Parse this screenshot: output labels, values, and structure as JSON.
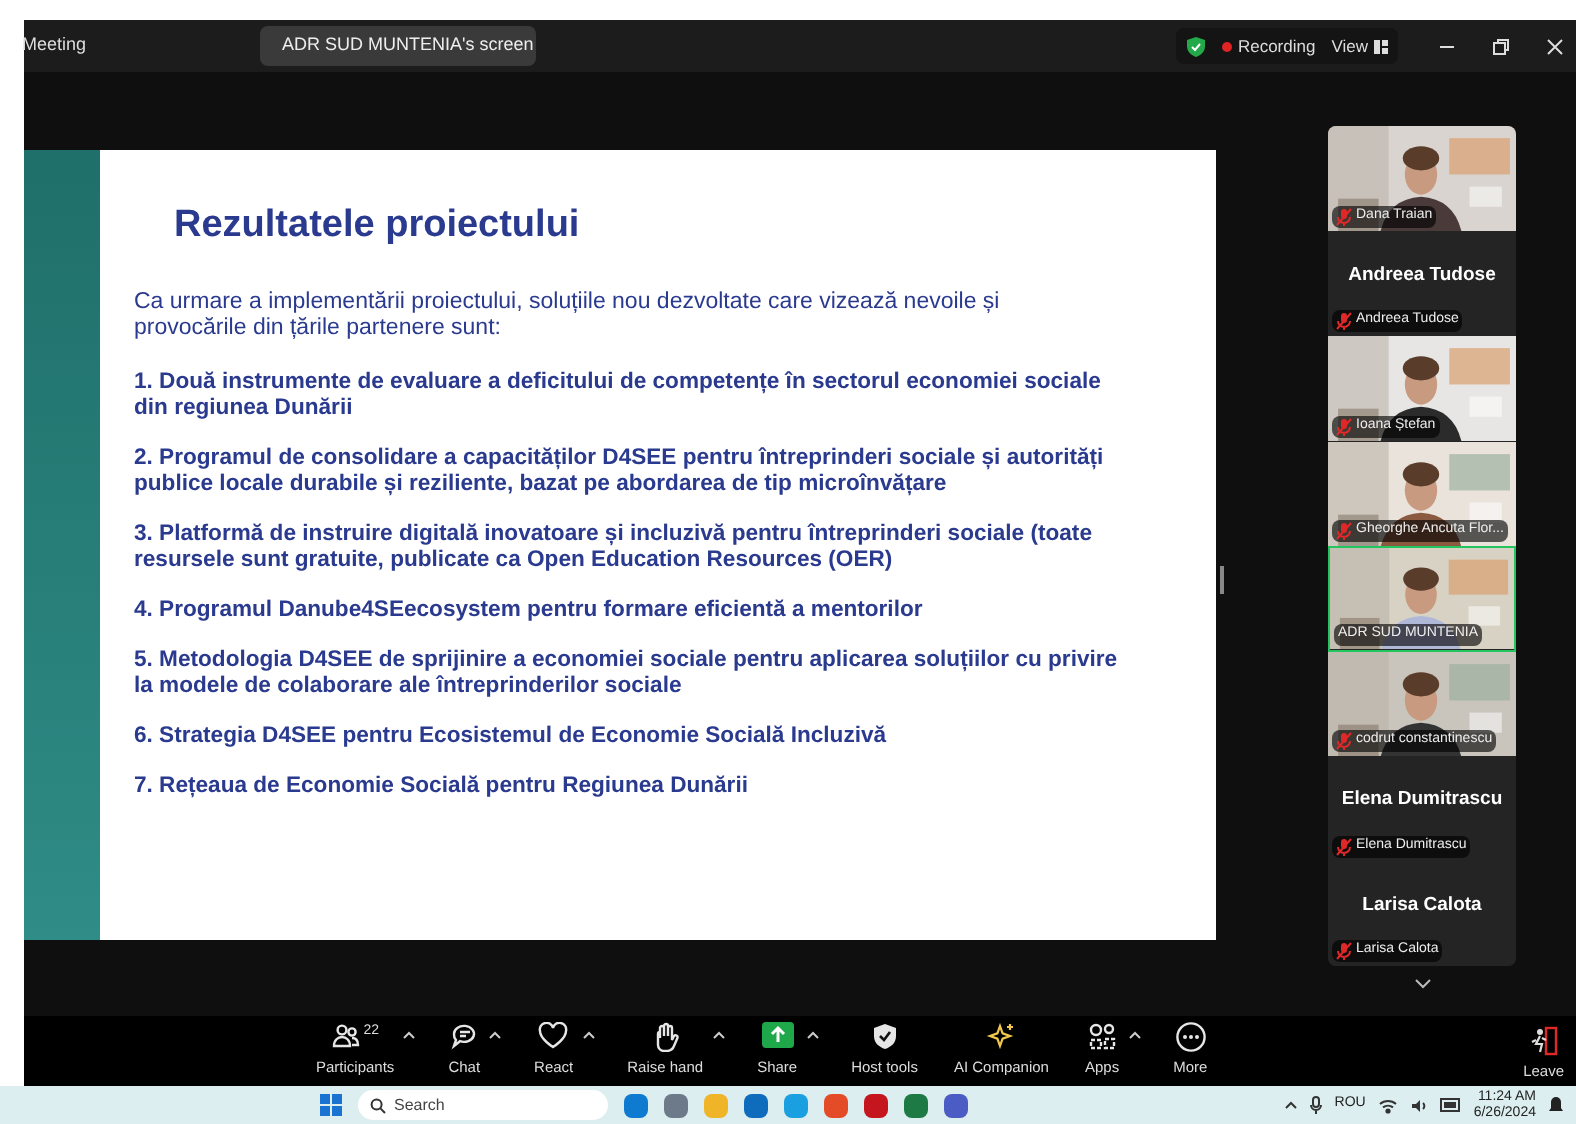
{
  "window": {
    "title": "Meeting"
  },
  "share_pill": {
    "label": "ADR SUD MUNTENIA's screen"
  },
  "top_right": {
    "recording": "Recording",
    "view": "View"
  },
  "slide": {
    "title": "Rezultatele proiectului",
    "intro": "Ca urmare a implementării proiectului, soluțiile nou dezvoltate care vizează nevoile și provocările din țările partenere sunt:",
    "items": [
      "1. Două instrumente de evaluare a deficitului de competențe în sectorul economiei sociale din regiunea Dunării",
      "2. Programul de consolidare a capacităților D4SEE pentru întreprinderi sociale și autorități publice locale durabile și reziliente, bazat pe abordarea de tip microînvățare",
      "3. Platformă de instruire digitală inovatoare și incluzivă pentru întreprinderi sociale (toate resursele sunt gratuite, publicate ca Open Education Resources (OER)",
      "4. Programul Danube4SEecosystem pentru formare eficientă a mentorilor",
      "5. Metodologia D4SEE de sprijinire a economiei sociale pentru aplicarea soluțiilor cu privire la modele de colaborare ale întreprinderilor sociale",
      "6. Strategia D4SEE pentru Ecosistemul de Economie Socială Incluzivă",
      "7. Rețeaua de Economie Socială pentru Regiunea Dunării"
    ]
  },
  "participants": [
    {
      "kind": "video",
      "name": "Dana Traian",
      "muted": true,
      "speaking": false
    },
    {
      "kind": "name",
      "title": "Andreea Tudose",
      "name": "Andreea Tudose",
      "muted": true,
      "speaking": false
    },
    {
      "kind": "video",
      "name": "Ioana Ștefan",
      "muted": true,
      "speaking": false
    },
    {
      "kind": "video",
      "name": "Gheorghe Ancuta Flor...",
      "muted": true,
      "speaking": false
    },
    {
      "kind": "video",
      "name": "ADR SUD MUNTENIA",
      "muted": false,
      "speaking": true
    },
    {
      "kind": "video",
      "name": "codrut constantinescu",
      "muted": true,
      "speaking": false
    },
    {
      "kind": "name",
      "title": "Elena Dumitrascu",
      "name": "Elena Dumitrascu",
      "muted": true,
      "speaking": false
    },
    {
      "kind": "name",
      "title": "Larisa Calota",
      "name": "Larisa Calota",
      "muted": true,
      "speaking": false
    }
  ],
  "toolbar": [
    {
      "kind": "participants",
      "label": "Participants",
      "count": "22",
      "caret": true
    },
    {
      "kind": "chat",
      "label": "Chat",
      "caret": true
    },
    {
      "kind": "react",
      "label": "React",
      "caret": true
    },
    {
      "kind": "hand",
      "label": "Raise hand",
      "caret": true
    },
    {
      "kind": "share",
      "label": "Share",
      "caret": true
    },
    {
      "kind": "host",
      "label": "Host tools",
      "caret": false
    },
    {
      "kind": "ai",
      "label": "AI Companion",
      "caret": false
    },
    {
      "kind": "apps",
      "label": "Apps",
      "caret": true
    },
    {
      "kind": "more",
      "label": "More",
      "caret": false
    }
  ],
  "leave": {
    "label": "Leave"
  },
  "taskbar": {
    "search_placeholder": "Search",
    "language": "ROU",
    "time": "11:24 AM",
    "date": "6/26/2024"
  }
}
